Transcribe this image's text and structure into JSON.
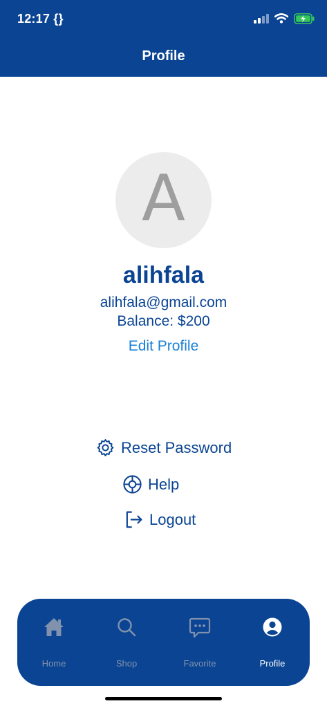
{
  "status_bar": {
    "time": "12:17 {}",
    "icons": [
      "signal-icon",
      "wifi-icon",
      "battery-charging-icon"
    ]
  },
  "header": {
    "title": "Profile"
  },
  "profile": {
    "avatar_letter": "A",
    "username": "alihfala",
    "email": "alihfala@gmail.com",
    "balance": "Balance: $200",
    "edit_label": "Edit Profile"
  },
  "menu": {
    "reset_password": "Reset Password",
    "help": "Help",
    "logout": "Logout"
  },
  "tabbar": {
    "tabs": [
      {
        "label": "Home",
        "icon": "home-icon",
        "active": false
      },
      {
        "label": "Shop",
        "icon": "search-icon",
        "active": false
      },
      {
        "label": "Favorite",
        "icon": "chat-bubble-icon",
        "active": false
      },
      {
        "label": "Profile",
        "icon": "user-circle-icon",
        "active": true
      }
    ]
  },
  "colors": {
    "primary": "#0a4493",
    "link": "#1a7fd6",
    "inactive_tab": "#8192ad",
    "avatar_bg": "#ececec",
    "battery": "#34c759"
  }
}
